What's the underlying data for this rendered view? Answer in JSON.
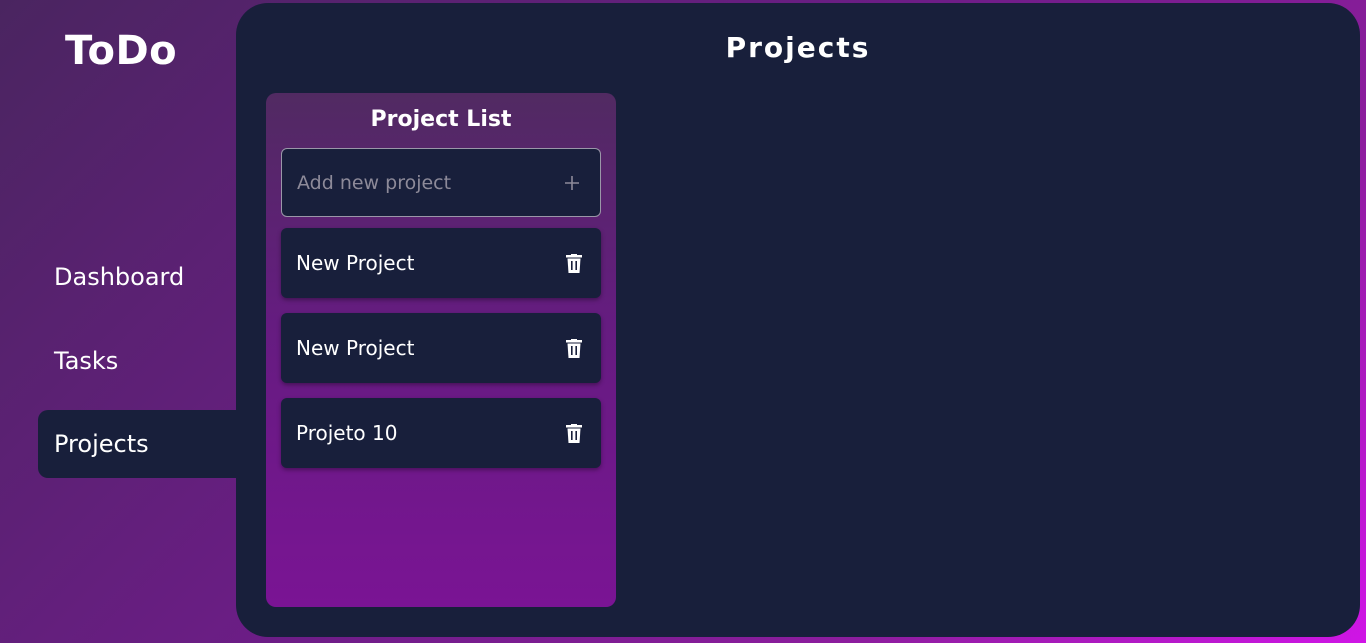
{
  "app": {
    "logo": "ToDo"
  },
  "sidebar": {
    "items": [
      {
        "label": "Dashboard",
        "active": false
      },
      {
        "label": "Tasks",
        "active": false
      },
      {
        "label": "Projects",
        "active": true
      }
    ]
  },
  "main": {
    "title": "Projects"
  },
  "project_panel": {
    "title": "Project List",
    "add_placeholder": "Add new project",
    "add_icon": "plus-icon",
    "projects": [
      {
        "name": "New Project",
        "icon": "trash-icon"
      },
      {
        "name": "New Project",
        "icon": "trash-icon"
      },
      {
        "name": "Projeto 10",
        "icon": "trash-icon"
      }
    ]
  },
  "colors": {
    "panel_bg": "#181f3b",
    "accent_gradient_end": "#d015e6",
    "text": "#ffffff"
  }
}
